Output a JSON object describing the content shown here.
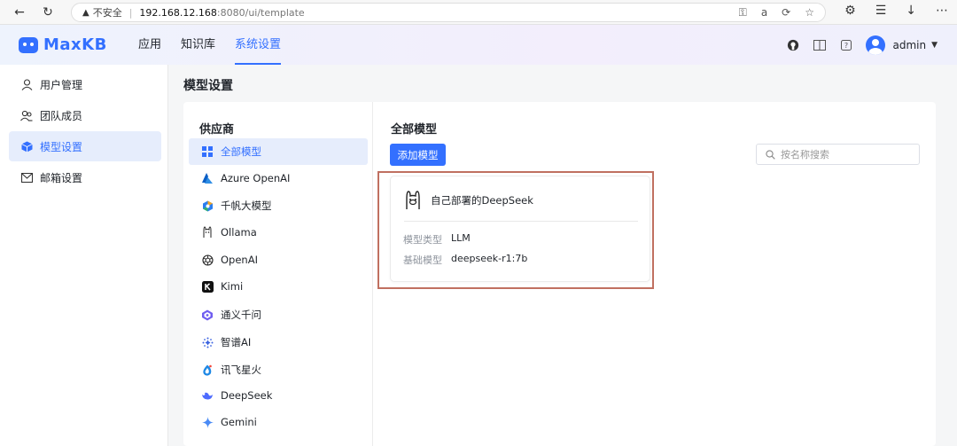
{
  "browser": {
    "insecure_label": "不安全",
    "url_host": "192.168.12.168",
    "url_path": ":8080/ui/template"
  },
  "header": {
    "logo_text": "MaxKB",
    "nav": [
      {
        "label": "应用"
      },
      {
        "label": "知识库"
      },
      {
        "label": "系统设置"
      }
    ],
    "user": "admin"
  },
  "sidebar": {
    "items": [
      {
        "label": "用户管理",
        "icon": "user-icon"
      },
      {
        "label": "团队成员",
        "icon": "team-icon"
      },
      {
        "label": "模型设置",
        "icon": "cube-icon"
      },
      {
        "label": "邮箱设置",
        "icon": "mail-icon"
      }
    ]
  },
  "page": {
    "title": "模型设置"
  },
  "providers": {
    "title": "供应商",
    "items": [
      {
        "label": "全部模型",
        "icon": "grid-icon"
      },
      {
        "label": "Azure OpenAI",
        "icon": "azure-icon"
      },
      {
        "label": "千帆大模型",
        "icon": "qianfan-icon"
      },
      {
        "label": "Ollama",
        "icon": "ollama-icon"
      },
      {
        "label": "OpenAI",
        "icon": "openai-icon"
      },
      {
        "label": "Kimi",
        "icon": "kimi-icon"
      },
      {
        "label": "通义千问",
        "icon": "tongyi-icon"
      },
      {
        "label": "智谱AI",
        "icon": "zhipu-icon"
      },
      {
        "label": "讯飞星火",
        "icon": "xunfei-icon"
      },
      {
        "label": "DeepSeek",
        "icon": "deepseek-icon"
      },
      {
        "label": "Gemini",
        "icon": "gemini-icon"
      }
    ]
  },
  "models": {
    "title": "全部模型",
    "add_button": "添加模型",
    "search_placeholder": "按名称搜索",
    "card": {
      "name": "自己部署的DeepSeek",
      "type_label": "模型类型",
      "type_value": "LLM",
      "base_label": "基础模型",
      "base_value": "deepseek-r1:7b"
    }
  },
  "colors": {
    "accent": "#3370ff",
    "highlight": "#c07060"
  }
}
